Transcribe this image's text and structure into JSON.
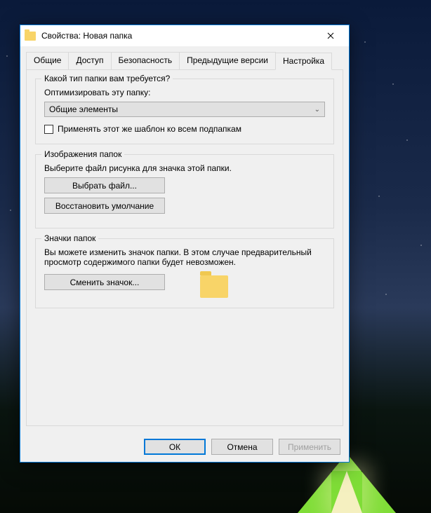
{
  "window": {
    "title": "Свойства: Новая папка"
  },
  "tabs": [
    "Общие",
    "Доступ",
    "Безопасность",
    "Предыдущие версии",
    "Настройка"
  ],
  "active_tab": "Настройка",
  "group_type": {
    "title": "Какой тип папки вам требуется?",
    "optimize_label": "Оптимизировать эту папку:",
    "select_value": "Общие элементы",
    "apply_subfolders": "Применять этот же шаблон ко всем подпапкам"
  },
  "group_images": {
    "title": "Изображения папок",
    "desc": "Выберите файл рисунка для значка этой папки.",
    "choose_btn": "Выбрать файл...",
    "restore_btn": "Восстановить умолчание"
  },
  "group_icons": {
    "title": "Значки папок",
    "desc": "Вы можете изменить значок папки. В этом случае предварительный просмотр содержимого папки будет невозможен.",
    "change_btn": "Сменить значок..."
  },
  "footer": {
    "ok": "ОК",
    "cancel": "Отмена",
    "apply": "Применить"
  }
}
